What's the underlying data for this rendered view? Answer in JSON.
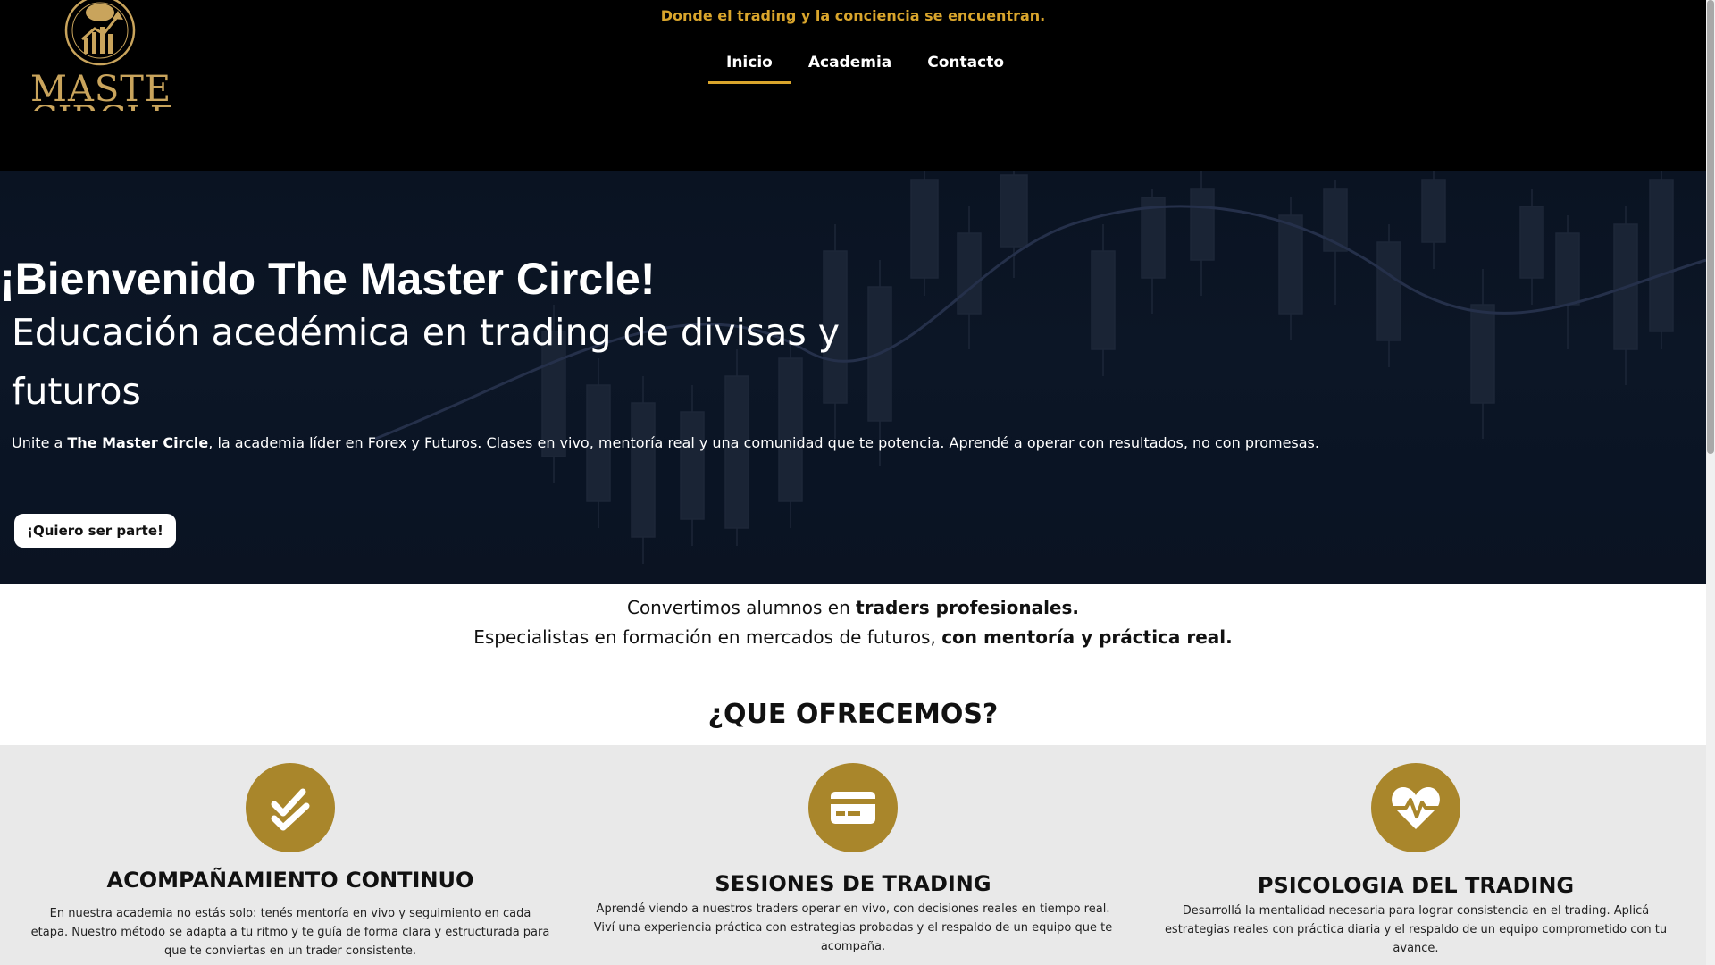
{
  "header": {
    "logo_text_line1": "MASTER",
    "logo_text_line2": "CIRCLE",
    "tagline": "Donde el trading y la conciencia se encuentran.",
    "nav": [
      {
        "label": "Inicio",
        "active": true
      },
      {
        "label": "Academia",
        "active": false
      },
      {
        "label": "Contacto",
        "active": false
      }
    ]
  },
  "hero": {
    "title": "¡Bienvenido The Master Circle!",
    "subtitle": "Educación acedémica en trading de divisas y futuros",
    "text_prefix": "Unite a ",
    "text_bold": "The Master Circle",
    "text_suffix": ", la academia líder en Forex y Futuros. Clases en vivo, mentoría real y una comunidad que te potencia. Aprendé a operar con resultados, no con promesas.",
    "cta_label": "¡Quiero ser parte!"
  },
  "intro": {
    "line1_prefix": "Convertimos alumnos en ",
    "line1_bold": "traders profesionales.",
    "line2_prefix": "Especialistas en formación en mercados de futuros, ",
    "line2_bold": "con mentoría y práctica real."
  },
  "offer": {
    "title": "¿QUE OFRECEMOS?",
    "features": [
      {
        "icon": "double-check-icon",
        "title": "ACOMPAÑAMIENTO CONTINUO",
        "description": "En nuestra academia no estás solo: tenés mentoría en vivo y seguimiento en cada etapa. Nuestro método se adapta a tu ritmo y te guía de forma clara y estructurada para que te conviertas en un trader consistente."
      },
      {
        "icon": "credit-card-icon",
        "title": "SESIONES DE TRADING",
        "description": "Aprendé viendo a nuestros traders operar en vivo, con decisiones reales en tiempo real. Viví una experiencia práctica con estrategias probadas y el respaldo de un equipo que te acompaña."
      },
      {
        "icon": "heartbeat-icon",
        "title": "PSICOLOGIA DEL TRADING",
        "description": "Desarrollá la mentalidad necesaria para lograr consistencia en el trading. Aplicá estrategias reales con práctica diaria y el respaldo de un equipo comprometido con tu avance."
      }
    ]
  },
  "colors": {
    "accent_gold": "#d9a52c",
    "icon_gold": "#a9862b",
    "header_bg": "#000000",
    "hero_bg": "#0b1424"
  }
}
